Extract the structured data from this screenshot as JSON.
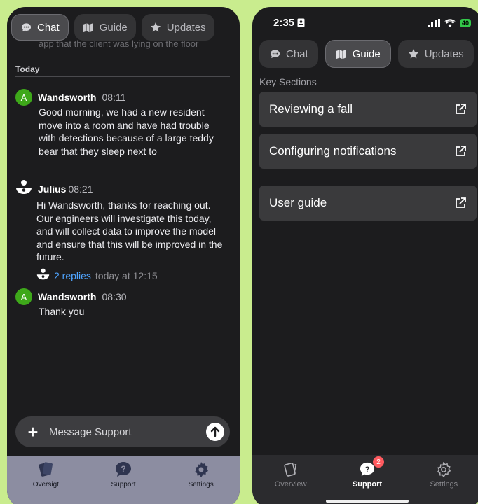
{
  "left": {
    "tabs": [
      {
        "label": "Chat",
        "icon": "chat-bubble-icon",
        "active": true
      },
      {
        "label": "Guide",
        "icon": "map-icon",
        "active": false
      },
      {
        "label": "Updates",
        "icon": "star-icon",
        "active": false
      }
    ],
    "cut_text": "app that the client was lying on the floor",
    "day_label": "Today",
    "messages": [
      {
        "avatar": "A",
        "author": "Wandsworth",
        "time": "08:11",
        "text": "Good morning, we had a new resident move into a room and have had trouble with detections because of a large teddy bear that they sleep next to"
      },
      {
        "avatar": "support-logo",
        "author": "Julius",
        "time": "08:21",
        "text": "Hi Wandsworth, thanks for reaching out. Our engineers will investigate this today, and will collect data to improve the model and ensure that this will be improved in the future.",
        "replies": "2 replies",
        "reply_time": "today at 12:15"
      },
      {
        "avatar": "A",
        "author": "Wandsworth",
        "time": "08:30",
        "text": "Thank you"
      }
    ],
    "composer": {
      "placeholder": "Message Support"
    },
    "bottom_nav": [
      {
        "label": "Oversigt",
        "icon": "overview-cards-icon"
      },
      {
        "label": "Support",
        "icon": "question-bubble-icon"
      },
      {
        "label": "Settings",
        "icon": "gear-icon"
      }
    ]
  },
  "right": {
    "status": {
      "time": "2:35",
      "battery": "40"
    },
    "tabs": [
      {
        "label": "Chat",
        "icon": "chat-bubble-icon",
        "active": false
      },
      {
        "label": "Guide",
        "icon": "map-icon",
        "active": true
      },
      {
        "label": "Updates",
        "icon": "star-icon",
        "active": false
      }
    ],
    "section_label": "Key Sections",
    "links": [
      {
        "label": "Reviewing a fall",
        "icon": "external-link-icon"
      },
      {
        "label": "Configuring notifications",
        "icon": "external-link-icon"
      },
      {
        "label": "User guide",
        "icon": "external-link-icon"
      }
    ],
    "bottom_nav": [
      {
        "label": "Overview",
        "icon": "overview-cards-icon",
        "active": false
      },
      {
        "label": "Support",
        "icon": "question-bubble-icon",
        "active": true,
        "badge": "2"
      },
      {
        "label": "Settings",
        "icon": "gear-icon",
        "active": false
      }
    ]
  },
  "colors": {
    "background": "#c9ec8e",
    "panel": "#1c1c1e",
    "link": "#4fa4ff",
    "avatar_green": "#3ea81a",
    "badge_red": "#ff5a5f"
  }
}
